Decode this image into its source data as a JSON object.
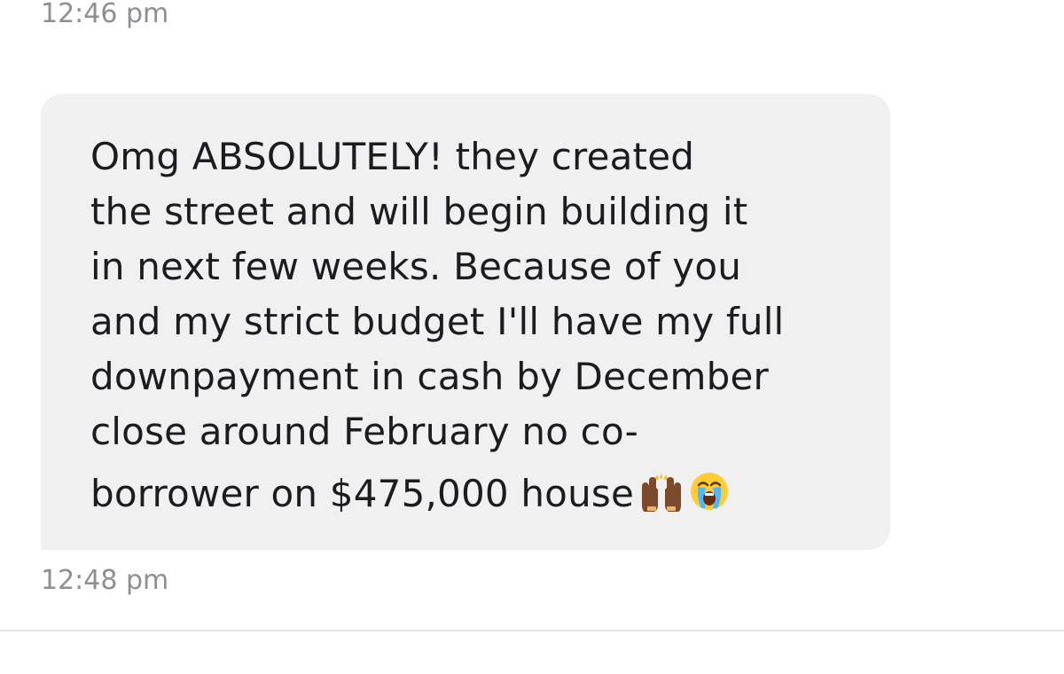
{
  "chat": {
    "timestamp_before": "12:46 pm",
    "message": {
      "lines": [
        "Omg ABSOLUTELY!  they created",
        "the street and will begin building it",
        "in next few weeks. Because of you",
        "and my strict budget I'll have my full",
        "downpayment in cash by December",
        "close around February no co-",
        "borrower on $475,000 house"
      ],
      "emojis": [
        "raising-hands-icon",
        "loudly-crying-face-icon"
      ]
    },
    "timestamp_after": "12:48 pm"
  },
  "colors": {
    "bubble_background": "#f0f0f1",
    "message_text": "#1c1c1e",
    "timestamp_text": "#8e8e93",
    "divider": "#e4e4e6",
    "page_background": "#ffffff"
  }
}
